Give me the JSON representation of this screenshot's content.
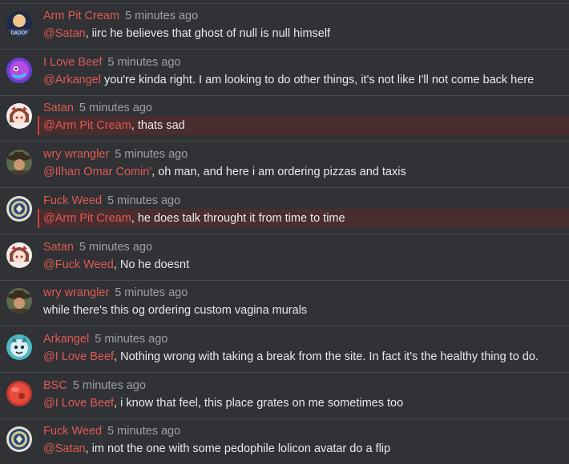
{
  "colors": {
    "background": "#303236",
    "author": "#e05a52",
    "mention": "#e05a52",
    "timestamp": "#9ea1a6",
    "text": "#e8e9eb",
    "highlight_bg": "#4a2d2f",
    "highlight_bar": "#d2423a"
  },
  "messages": [
    {
      "author": "Arm Pit Cream",
      "time": "5 minutes ago",
      "mention": "@Satan",
      "text": ", iirc he believes that ghost of null is null himself",
      "avatar_icon": "daddy-avatar-icon",
      "avatar_text": "DADDY",
      "highlighted": false
    },
    {
      "author": "I Love Beef",
      "time": "5 minutes ago",
      "mention": "@Arkangel",
      "text": " you're kinda right. I am looking to do other things, it's not like I'll not come back here",
      "avatar_icon": "purple-creature-avatar-icon",
      "highlighted": false
    },
    {
      "author": "Satan",
      "time": "5 minutes ago",
      "mention": "@Arm Pit Cream",
      "text": ", thats sad",
      "avatar_icon": "anime-girl-avatar-icon",
      "highlighted": true
    },
    {
      "author": "wry wrangler",
      "time": "5 minutes ago",
      "mention": "@Ilhan Omar Comin'",
      "text": ", oh man, and here i am ordering pizzas and taxis",
      "avatar_icon": "cowboy-avatar-icon",
      "highlighted": false
    },
    {
      "author": "Fuck Weed",
      "time": "5 minutes ago",
      "mention": "@Arm Pit Cream",
      "text": ", he does talk throught it from time to time",
      "avatar_icon": "seal-avatar-icon",
      "highlighted": true
    },
    {
      "author": "Satan",
      "time": "5 minutes ago",
      "mention": "@Fuck Weed",
      "text": ", No he doesnt",
      "avatar_icon": "anime-girl-avatar-icon",
      "highlighted": false
    },
    {
      "author": "wry wrangler",
      "time": "5 minutes ago",
      "mention": "",
      "text": "while there's this og ordering custom vagina murals",
      "avatar_icon": "cowboy-avatar-icon",
      "highlighted": false
    },
    {
      "author": "Arkangel",
      "time": "5 minutes ago",
      "mention": "@I Love Beef",
      "text": ", Nothing wrong with taking a break from the site. In fact it's the healthy thing to do.",
      "avatar_icon": "teal-creature-avatar-icon",
      "highlighted": false
    },
    {
      "author": "BSC",
      "time": "5 minutes ago",
      "mention": "@I Love Beef",
      "text": ", i know that feel, this place grates on me sometimes too",
      "avatar_icon": "red-ball-avatar-icon",
      "highlighted": false
    },
    {
      "author": "Fuck Weed",
      "time": "5 minutes ago",
      "mention": "@Satan",
      "text": ", im not the one with some pedophile lolicon avatar do a flip",
      "avatar_icon": "seal-avatar-icon",
      "highlighted": false
    }
  ]
}
